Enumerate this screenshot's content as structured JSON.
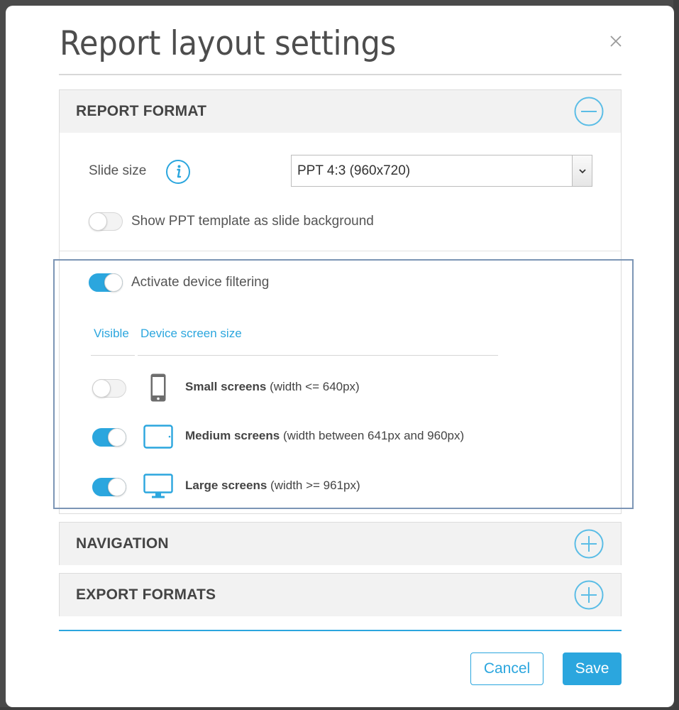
{
  "dialog": {
    "title": "Report layout settings"
  },
  "sections": {
    "report_format": {
      "title": "REPORT FORMAT",
      "expanded": true,
      "slide_size_label": "Slide size",
      "slide_size_value": "PPT 4:3 (960x720)",
      "ppt_template_label": "Show PPT template as slide background",
      "ppt_template_on": false,
      "device_filtering_label": "Activate device filtering",
      "device_filtering_on": true,
      "columns": {
        "visible": "Visible",
        "device_screen_size": "Device screen size"
      },
      "devices": [
        {
          "name": "Small screens",
          "detail": "(width <= 640px)",
          "icon": "phone-icon",
          "visible": false
        },
        {
          "name": "Medium screens",
          "detail": "(width between 641px and 960px)",
          "icon": "tablet-icon",
          "visible": true
        },
        {
          "name": "Large screens",
          "detail": "(width >= 961px)",
          "icon": "monitor-icon",
          "visible": true
        }
      ]
    },
    "navigation": {
      "title": "NAVIGATION",
      "expanded": false
    },
    "export_formats": {
      "title": "EXPORT FORMATS",
      "expanded": false
    }
  },
  "footer": {
    "cancel_label": "Cancel",
    "save_label": "Save"
  },
  "colors": {
    "accent": "#2ba6de",
    "highlight_border": "#7c95b5",
    "icon_gray": "#6d6d6d"
  }
}
